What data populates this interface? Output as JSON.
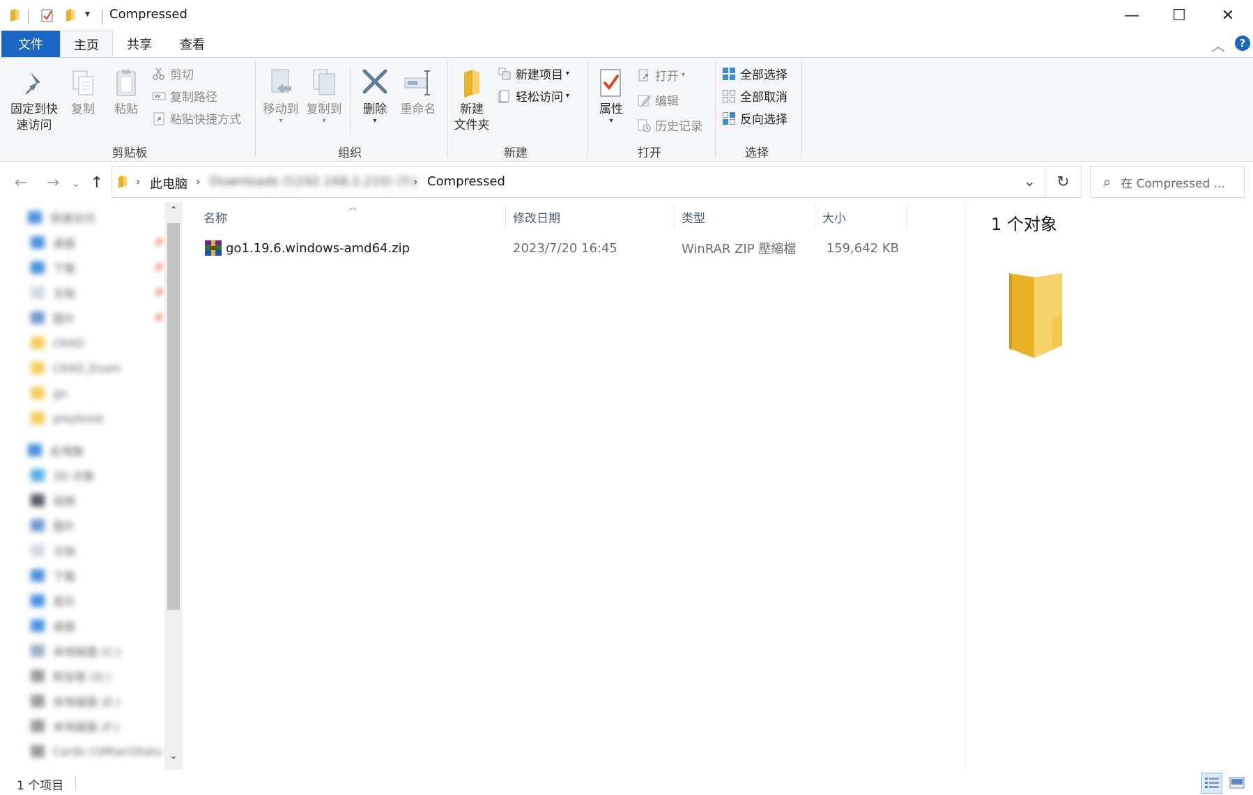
{
  "window": {
    "title": "Compressed",
    "qa_customize_caret": "▾",
    "minimize_glyph": "—",
    "maximize_glyph": "☐",
    "close_glyph": "✕"
  },
  "tabs": [
    {
      "label": "文件"
    },
    {
      "label": "主页"
    },
    {
      "label": "共享"
    },
    {
      "label": "查看"
    }
  ],
  "ribbon": {
    "collapse_glyph": "︿",
    "help_glyph": "?",
    "clipboard": {
      "pin_label_1": "固定到快",
      "pin_label_2": "速访问",
      "copy_label": "复制",
      "paste_label": "粘贴",
      "cut_label": "剪切",
      "copy_path_label": "复制路径",
      "paste_shortcut_label": "粘贴快捷方式",
      "group_label": "剪贴板"
    },
    "organize": {
      "move_to_label": "移动到",
      "copy_to_label": "复制到",
      "delete_label": "删除",
      "rename_label": "重命名",
      "group_label": "组织"
    },
    "new": {
      "new_folder_label_1": "新建",
      "new_folder_label_2": "文件夹",
      "new_item_label": "新建项目",
      "easy_access_label": "轻松访问",
      "group_label": "新建"
    },
    "open": {
      "properties_label": "属性",
      "open_label": "打开",
      "edit_label": "编辑",
      "history_label": "历史记录",
      "group_label": "打开"
    },
    "select": {
      "select_all_label": "全部选择",
      "select_none_label": "全部取消",
      "invert_label": "反向选择",
      "group_label": "选择"
    }
  },
  "address": {
    "back_glyph": "←",
    "forward_glyph": "→",
    "recent_glyph": "⌄",
    "up_glyph": "↑",
    "crumbs": [
      "此电脑",
      "Downloads (\\\\192.168.2.210) (Y:)",
      "Compressed"
    ],
    "crumb_sep": "›",
    "dropdown_glyph": "⌄",
    "refresh_glyph": "↻",
    "search_glyph": "⌕",
    "search_placeholder": "在 Compressed ..."
  },
  "navpane": {
    "quick_access": "快速访问",
    "quick_items": [
      {
        "label": "桌面",
        "color": "#2b7fd9"
      },
      {
        "label": "下载",
        "color": "#2b7fd9"
      },
      {
        "label": "文档",
        "color": "#c9d4e3"
      },
      {
        "label": "图片",
        "color": "#5a86c8"
      },
      {
        "label": "CKAD",
        "color": "#f4c53f"
      },
      {
        "label": "CKAD_Exam",
        "color": "#f4c53f"
      },
      {
        "label": "go",
        "color": "#f4c53f"
      },
      {
        "label": "playbook",
        "color": "#f4c53f"
      }
    ],
    "this_pc": "此电脑",
    "pc_items": [
      {
        "label": "3D 对象",
        "color": "#36a3d9"
      },
      {
        "label": "视频",
        "color": "#3a3f4d"
      },
      {
        "label": "图片",
        "color": "#5a86c8"
      },
      {
        "label": "文档",
        "color": "#c9d4e3"
      },
      {
        "label": "下载",
        "color": "#2b7fd9"
      },
      {
        "label": "音乐",
        "color": "#2b7fd9"
      },
      {
        "label": "桌面",
        "color": "#2b7fd9"
      },
      {
        "label": "本地磁盘 (C:)",
        "color": "#8aa0b8"
      },
      {
        "label": "新加卷 (D:)",
        "color": "#8a8a8a"
      },
      {
        "label": "本地磁盘 (E:)",
        "color": "#8a8a8a"
      },
      {
        "label": "本地磁盘 (F:)",
        "color": "#8a8a8a"
      },
      {
        "label": "Cardo (\\\\Mtan\\Statu",
        "color": "#8a8a8a"
      }
    ],
    "pin_glyph": "📌",
    "scroll_up_glyph": "⌃",
    "scroll_down_glyph": "⌄"
  },
  "filelist": {
    "sort_glyph": "︿",
    "columns": {
      "name": "名称",
      "modified": "修改日期",
      "type": "类型",
      "size": "大小"
    },
    "files": [
      {
        "name": "go1.19.6.windows-amd64.zip",
        "modified": "2023/7/20 16:45",
        "type": "WinRAR ZIP 壓縮檔",
        "size": "159,642 KB",
        "icon": "winrar-zip-icon"
      }
    ]
  },
  "preview": {
    "count_label": "1 个对象",
    "icon": "folder-large-icon"
  },
  "status": {
    "item_count": "1 个项目",
    "views": [
      "details-view-icon",
      "large-icons-view-icon"
    ]
  }
}
